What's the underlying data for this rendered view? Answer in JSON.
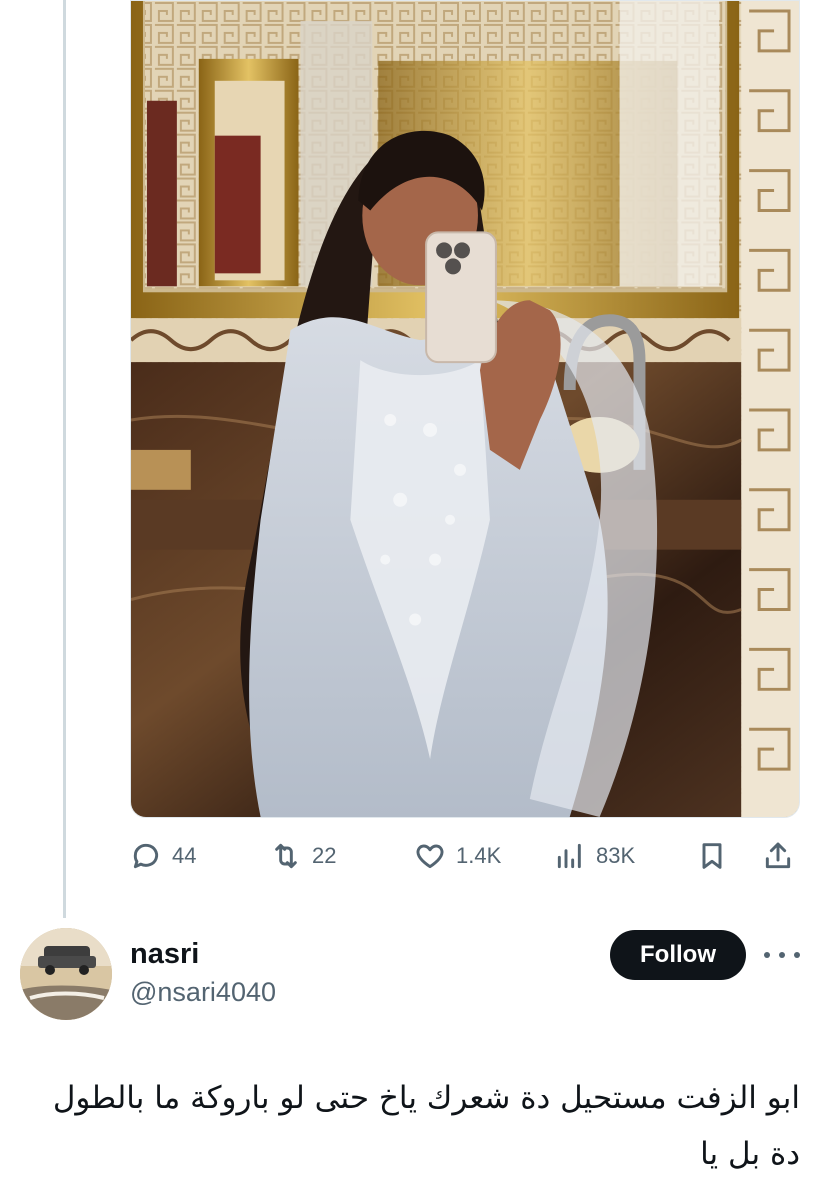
{
  "tweet": {
    "media": {
      "description_icon": "photo",
      "colors": {
        "mirror_frame": "#b8902a",
        "wall_pattern": "#d8c7a4",
        "marble": "#3b2417",
        "dress": "#c5ccd6",
        "phone": "#e7ddd3"
      }
    },
    "actions": {
      "reply_count": "44",
      "repost_count": "22",
      "like_count": "1.4K",
      "views_count": "83K"
    }
  },
  "reply": {
    "display_name": "nasri",
    "handle": "@nsari4040",
    "follow_label": "Follow",
    "text": "ابو الزفت مستحيل دة شعرك ياخ حتى لو باروكة ما بالطول دة بل يا"
  }
}
